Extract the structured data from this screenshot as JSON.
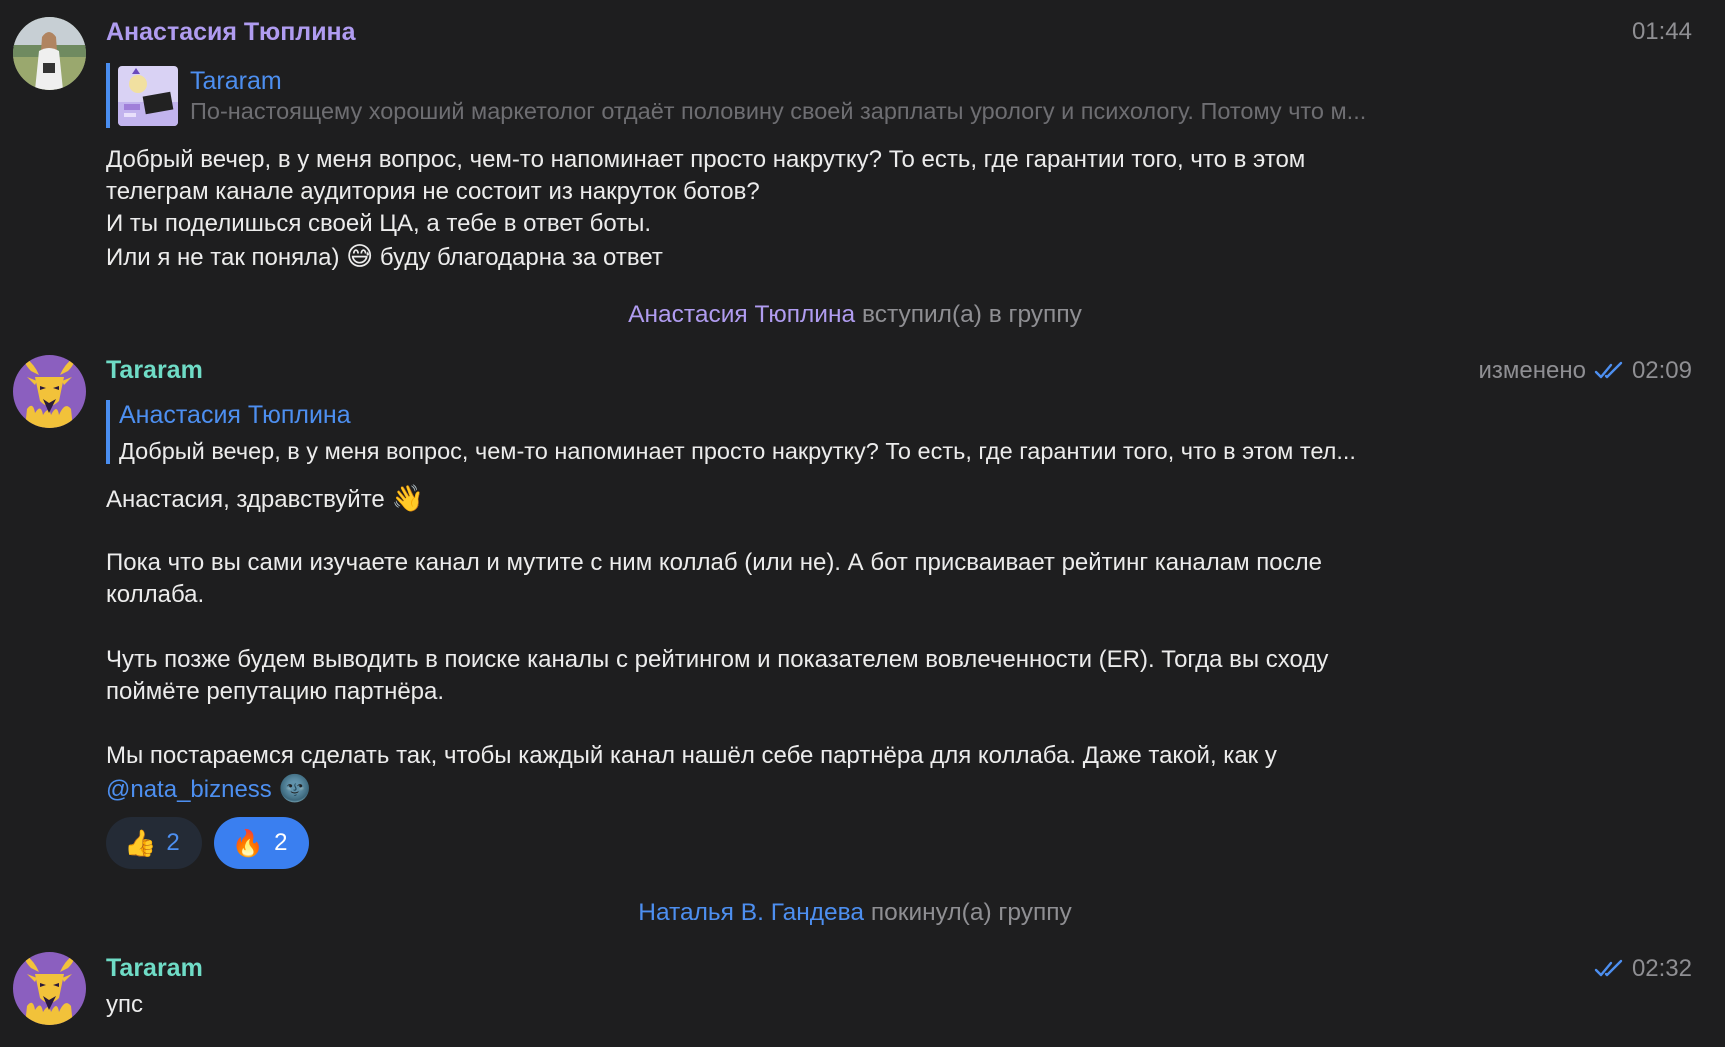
{
  "messages": [
    {
      "sender": "Анастасия Тюплина",
      "time": "01:44",
      "reply": {
        "name": "Tararam",
        "text": "По-настоящему хороший маркетолог отдаёт половину своей зарплаты урологу и психологу. Потому что м..."
      },
      "lines": [
        "Добрый вечер, в у меня вопрос, чем-то напоминает просто накрутку? То есть, где гарантии того, что в этом",
        "телеграм канале аудитория не состоит из накруток ботов?",
        "И ты поделишься своей ЦА, а тебе в ответ боты.",
        "Или я не так поняла)",
        "😅",
        "буду благодарна за ответ"
      ]
    },
    {
      "sender": "Tararam",
      "edited_label": "изменено",
      "time": "02:09",
      "reply": {
        "name": "Анастасия Тюплина",
        "text": "Добрый вечер, в у меня вопрос, чем-то напоминает просто накрутку? То есть, где гарантии того, что в этом тел..."
      },
      "greeting": "Анастасия, здравствуйте",
      "greeting_emoji": "👋",
      "paragraph1": [
        "Пока что вы сами изучаете канал и мутите с ним коллаб (или не). А бот присваивает рейтинг каналам после",
        "коллаба."
      ],
      "paragraph2": [
        "Чуть позже будем выводить в поиске каналы с рейтингом и показателем вовлеченности (ER). Тогда вы сходу",
        "поймёте репутацию партнёра."
      ],
      "paragraph3": "Мы постараемся сделать так, чтобы каждый канал нашёл себе партнёра для коллаба. Даже такой, как у",
      "mention": "@nata_bizness",
      "mention_emoji": "🌚",
      "reactions": [
        {
          "emoji": "👍",
          "count": "2"
        },
        {
          "emoji": "🔥",
          "count": "2"
        }
      ]
    },
    {
      "sender": "Tararam",
      "time": "02:32",
      "text": "упс"
    }
  ],
  "service": [
    {
      "name": "Анастасия Тюплина",
      "action": "вступил(а) в группу"
    },
    {
      "name": "Наталья В. Гандева",
      "action": "покинул(а) группу"
    }
  ],
  "colors": {
    "background": "#1e1e1f",
    "name_purple": "#b09cf0",
    "name_teal": "#6fdcc6",
    "accent_blue": "#4d8ff0",
    "reaction_active": "#3a7ff0",
    "reaction_inactive": "#242b36"
  }
}
